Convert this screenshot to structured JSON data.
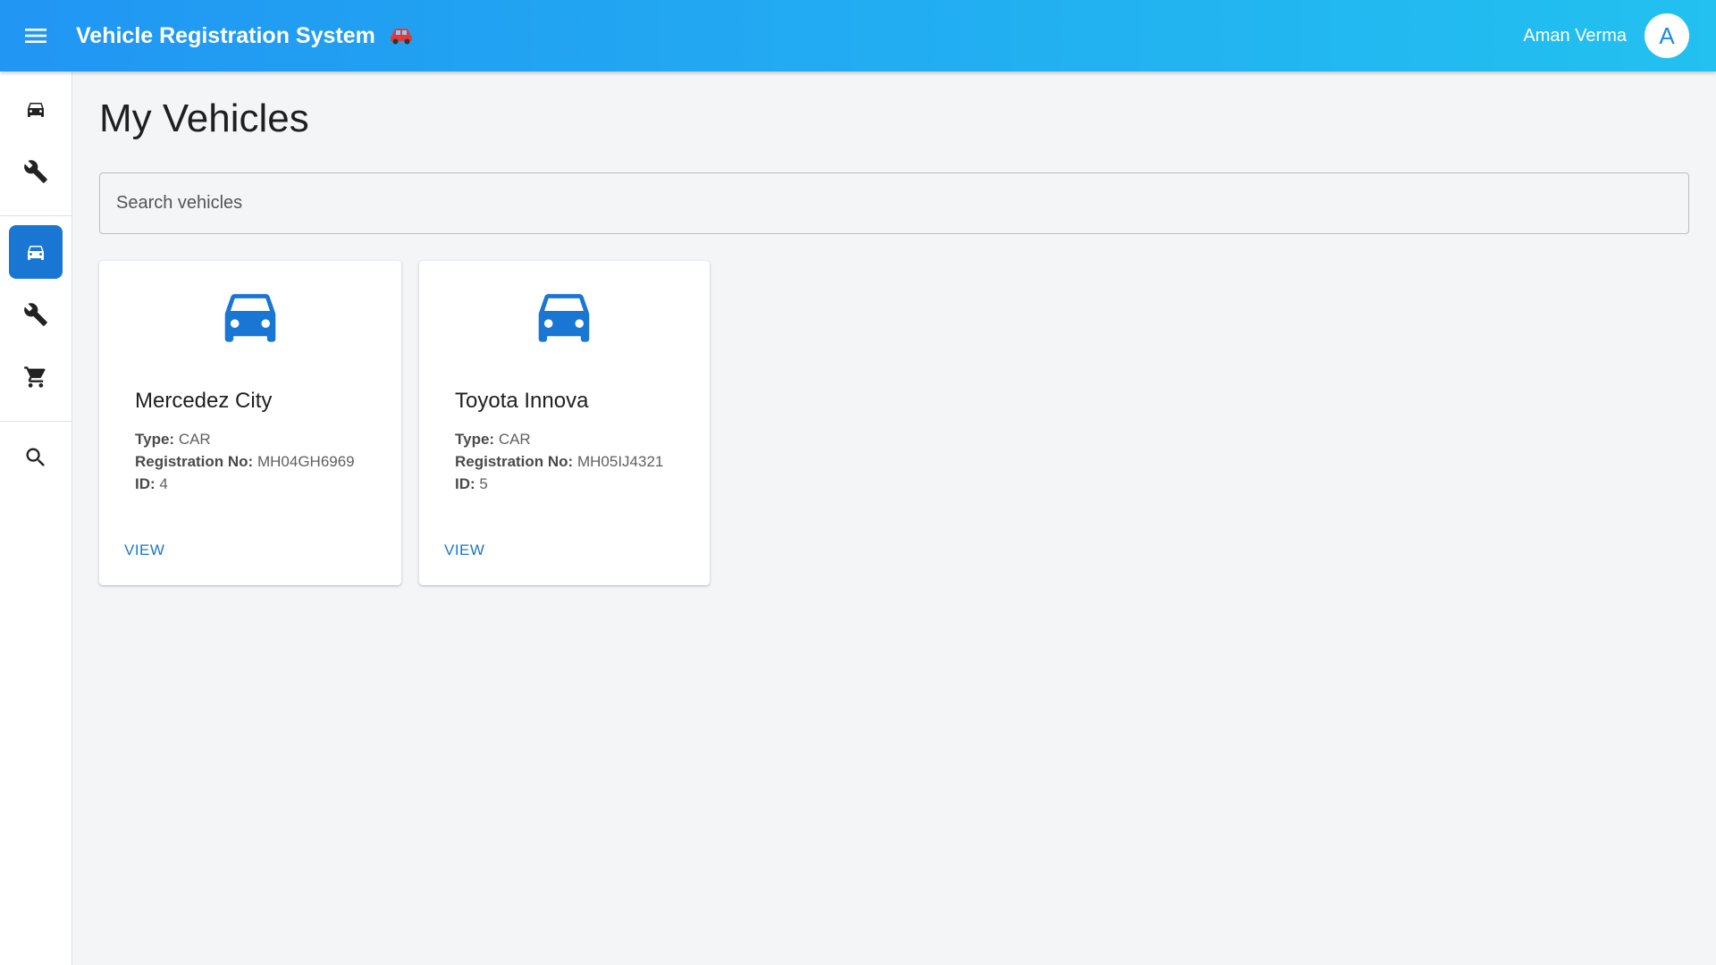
{
  "header": {
    "app_title": "Vehicle Registration System",
    "user_name": "Aman Verma",
    "avatar_initial": "A",
    "title_emoji_icon": "red-car-emoji-icon"
  },
  "sidebar": {
    "items": [
      {
        "icon": "car-icon",
        "active": false
      },
      {
        "icon": "wrench-icon",
        "active": false
      },
      {
        "icon": "car-icon",
        "active": true
      },
      {
        "icon": "wrench-icon",
        "active": false
      },
      {
        "icon": "cart-icon",
        "active": false
      },
      {
        "icon": "search-icon",
        "active": false
      }
    ]
  },
  "main": {
    "page_title": "My Vehicles",
    "search_placeholder": "Search vehicles",
    "labels": {
      "type": "Type:",
      "registration": "Registration No:",
      "id": "ID:",
      "view": "VIEW"
    },
    "vehicles": [
      {
        "name": "Mercedez City",
        "type": "CAR",
        "registration_no": "MH04GH6969",
        "id": "4"
      },
      {
        "name": "Toyota Innova",
        "type": "CAR",
        "registration_no": "MH05IJ4321",
        "id": "5"
      }
    ]
  },
  "colors": {
    "header_start": "#2196f3",
    "header_end": "#22c1f0",
    "accent": "#1976d2",
    "background": "#f4f5f7"
  }
}
